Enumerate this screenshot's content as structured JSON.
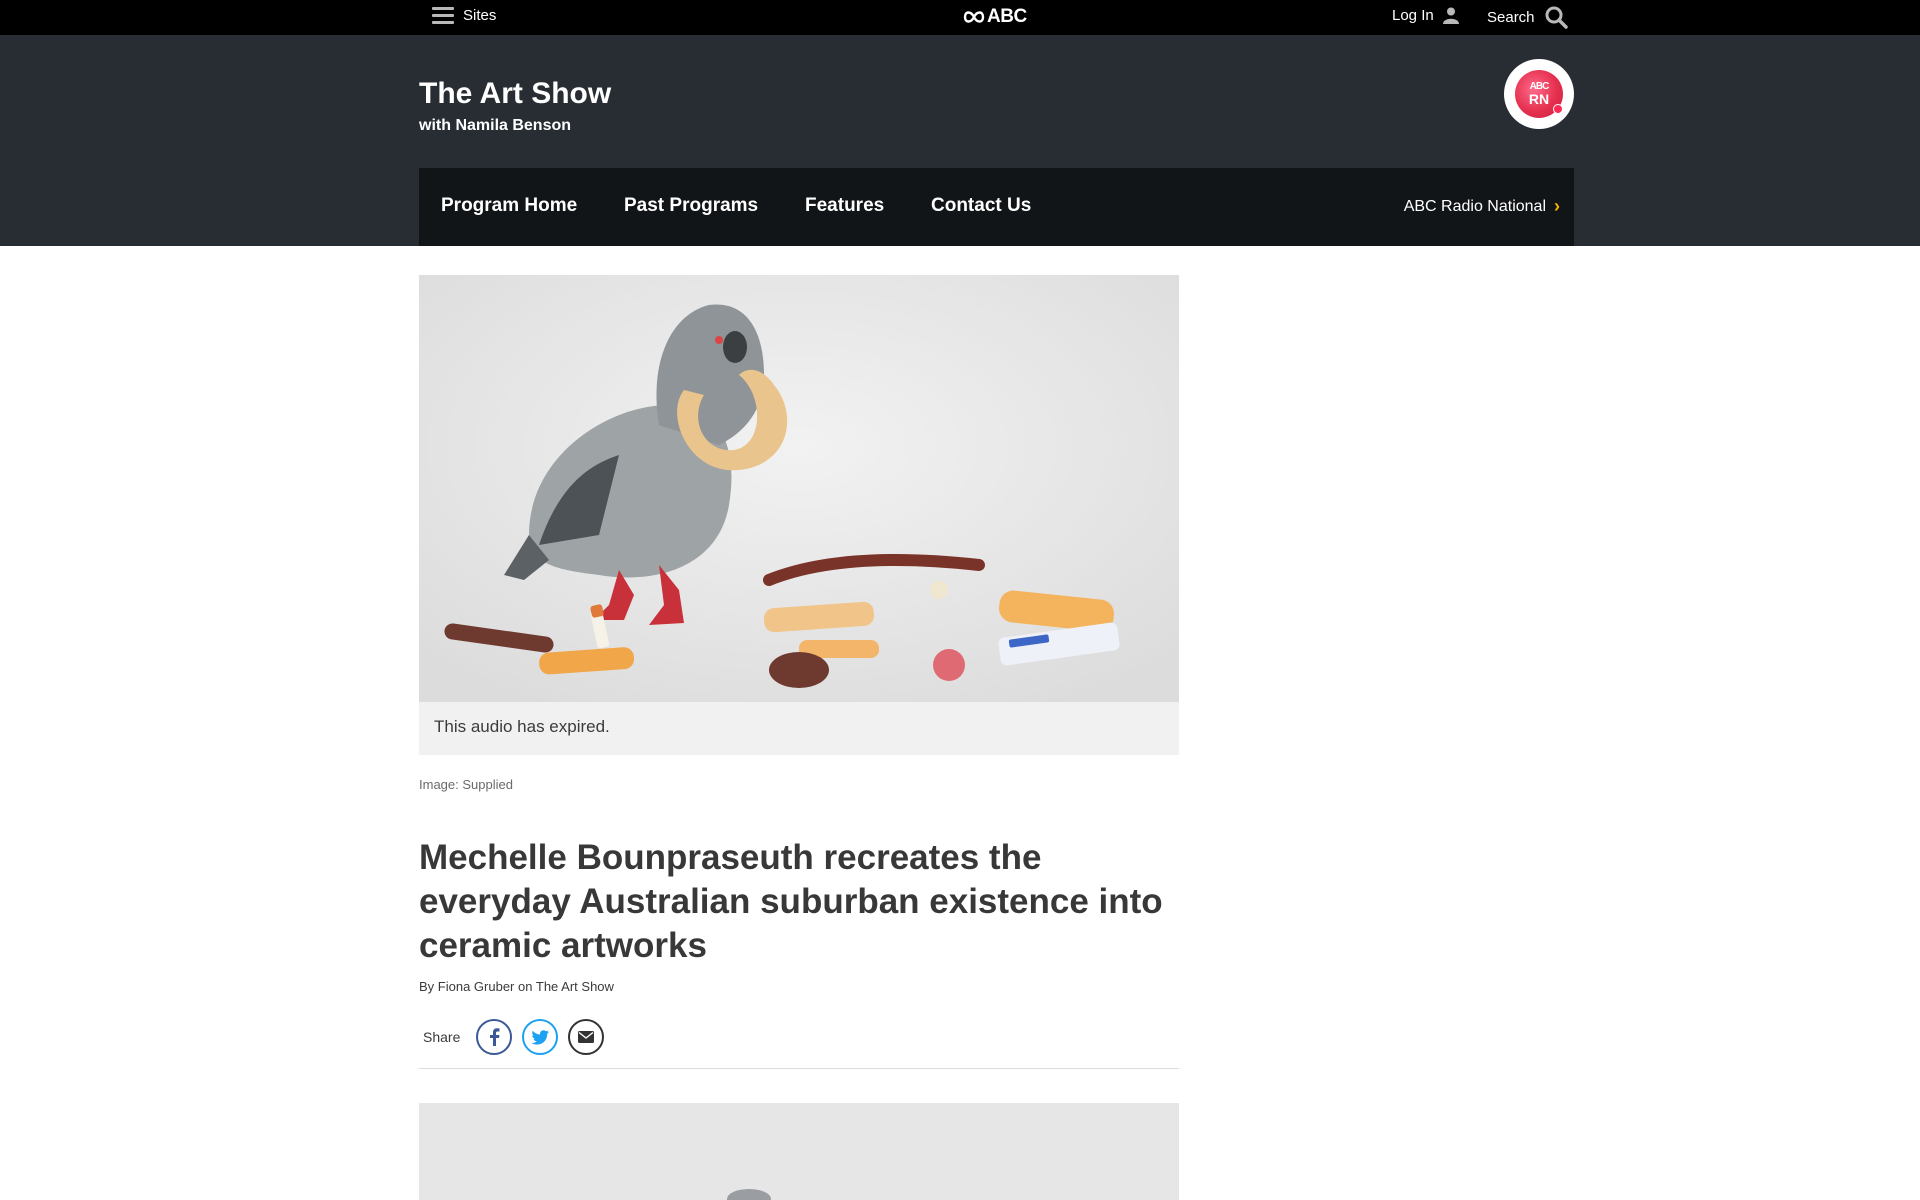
{
  "global_nav": {
    "sites_label": "Sites",
    "brand": "ABC",
    "login_label": "Log In",
    "search_label": "Search"
  },
  "program": {
    "title": "The Art Show",
    "subtitle": "with Namila Benson",
    "logo_text_top": "ABC",
    "logo_text": "RN"
  },
  "program_menu": {
    "items": [
      "Program Home",
      "Past Programs",
      "Features",
      "Contact Us"
    ],
    "network_link": "ABC Radio National",
    "chevron": "›"
  },
  "article": {
    "audio_status": "This audio has expired.",
    "image_caption": "Image: Supplied",
    "headline": "Mechelle Bounpraseuth recreates the everyday Australian suburban existence into ceramic artworks",
    "byline_prefix": "By",
    "author": "Fiona Gruber",
    "byline_on": "on",
    "program_link": "The Art Show",
    "share_label": "Share"
  },
  "colors": {
    "topbar": "#000000",
    "header_bg": "#272d33",
    "menu_bg": "#121517",
    "accent_chevron": "#f5b400",
    "rn_red": "#e5304f",
    "facebook": "#3b5998",
    "twitter": "#1da1f2"
  },
  "icons": {
    "menu": "hamburger-icon",
    "user": "user-icon",
    "search": "search-icon",
    "facebook": "facebook-icon",
    "twitter": "twitter-icon",
    "email": "email-icon"
  }
}
